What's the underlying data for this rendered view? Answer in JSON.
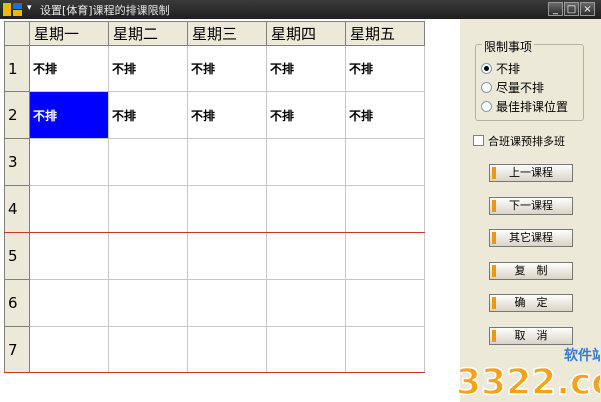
{
  "window": {
    "title": "设置[体育]课程的排课限制",
    "menu_arrow": "▾",
    "minimize": "_",
    "maximize": "□",
    "close": "×"
  },
  "grid": {
    "columns": [
      "星期一",
      "星期二",
      "星期三",
      "星期四",
      "星期五"
    ],
    "rows": [
      {
        "label": "1",
        "cells": [
          "不排",
          "不排",
          "不排",
          "不排",
          "不排"
        ]
      },
      {
        "label": "2",
        "cells": [
          "不排",
          "不排",
          "不排",
          "不排",
          "不排"
        ]
      },
      {
        "label": "3",
        "cells": [
          "",
          "",
          "",
          "",
          ""
        ]
      },
      {
        "label": "4",
        "cells": [
          "",
          "",
          "",
          "",
          ""
        ]
      },
      {
        "label": "5",
        "cells": [
          "",
          "",
          "",
          "",
          ""
        ]
      },
      {
        "label": "6",
        "cells": [
          "",
          "",
          "",
          "",
          ""
        ]
      },
      {
        "label": "7",
        "cells": [
          "",
          "",
          "",
          "",
          ""
        ]
      }
    ],
    "selected_cell": "row 2, 星期一"
  },
  "restriction": {
    "title": "限制事项",
    "options": [
      {
        "label": "不排",
        "selected": true
      },
      {
        "label": "尽量不排",
        "selected": false
      },
      {
        "label": "最佳排课位置",
        "selected": false
      }
    ]
  },
  "checkbox": {
    "label": "合班课预排多班",
    "checked": false
  },
  "buttons": {
    "prev": "上一课程",
    "next": "下一课程",
    "other": "其它课程",
    "copy": "复　制",
    "ok": "确　定",
    "cancel": "取　消"
  },
  "watermark": {
    "text": "3322.cc",
    "site": "软件站"
  },
  "colors": {
    "selected_cell": "#0000ff",
    "button_stripe": "#e59a1a",
    "period_divider": "#c0392b",
    "window_bg": "#ece9d8"
  }
}
